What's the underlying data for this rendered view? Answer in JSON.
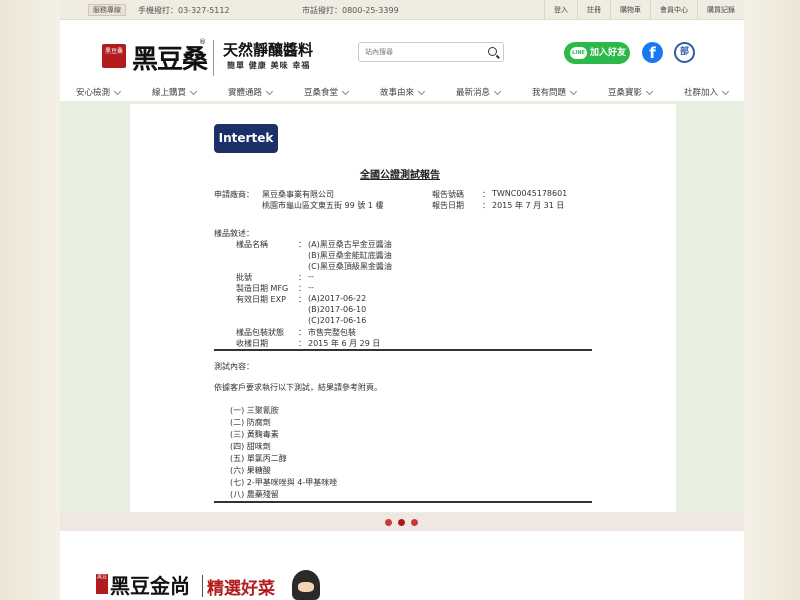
{
  "topbar": {
    "hotline_btn": "服務專線",
    "mobile": "手機撥打：03-327-5112",
    "landline": "市話撥打：0800-25-3399",
    "links": [
      "登入",
      "註冊",
      "購物車",
      "會員中心",
      "購買記錄"
    ]
  },
  "header": {
    "seal_text": "黑豆桑",
    "brand": "黑豆桑",
    "reg_mark": "®",
    "slogan": "天然靜釀醬料",
    "slogan_sub": "簡單 健康 美味 幸福",
    "search_placeholder": "站內搜尋",
    "line_btn": "加入好友",
    "line_icon": "LINE",
    "fb_icon": "f",
    "blog_icon": "部"
  },
  "nav": {
    "items": [
      "安心檢測",
      "線上購買",
      "實體通路",
      "豆桑食堂",
      "故事由來",
      "最新消息",
      "我有問題",
      "豆桑寶影",
      "社群加入"
    ]
  },
  "report": {
    "logo": "Intertek",
    "title": "全國公證測試報告",
    "applicant_label": "申請廠商：",
    "applicant_name": "黑豆桑事業有限公司",
    "applicant_addr": "桃園市龜山區文東五街 99 號 1 樓",
    "report_no_label": "報告號碼",
    "report_no": "TWNC0045178601",
    "report_date_label": "報告日期",
    "report_date": "2015 年 7 月 31 日",
    "sample_desc": "樣品敘述：",
    "product_name_label": "樣品名稱",
    "products": [
      "(A)黑豆桑古早金豆醬油",
      "(B)黑豆桑金能缸底醬油",
      "(C)黑豆桑頂級黑金醬油"
    ],
    "batch_label": "批號",
    "batch_value": "--",
    "mfg_label": "製造日期 MFG",
    "mfg_value": "--",
    "exp_label": "有效日期 EXP",
    "exp_values": [
      "(A)2017-06-22",
      "(B)2017-06-10",
      "(C)2017-06-16"
    ],
    "package_label": "樣品包裝狀態",
    "package_value": "市售完整包裝",
    "received_label": "收樣日期",
    "received_value": "2015 年 6 月 29 日",
    "colon": "：",
    "test_content": "測試內容：",
    "test_note": "依據客戶要求執行以下測試，結果請參考附頁。",
    "tests": [
      "(一) 三聚氰胺",
      "(二) 防腐劑",
      "(三) 黃麴毒素",
      "(四) 甜味劑",
      "(五) 單氯丙二醇",
      "(六) 果糖酸",
      "(七) 2-甲基咪唑與 4-甲基咪唑",
      "(八) 農藥殘留"
    ]
  },
  "footer": {
    "seal": "黑豆",
    "name": "黑豆金尚",
    "tag": "精選好菜"
  }
}
